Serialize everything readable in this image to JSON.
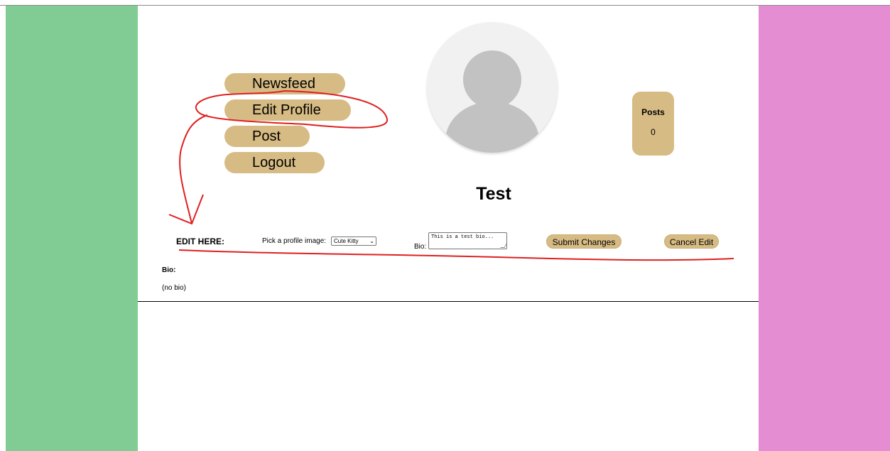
{
  "nav": {
    "newsfeed_label": "Newsfeed",
    "edit_profile_label": "Edit Profile",
    "post_label": "Post",
    "logout_label": "Logout"
  },
  "profile": {
    "username": "Test",
    "posts_label": "Posts",
    "posts_count": "0"
  },
  "edit_form": {
    "heading": "EDIT HERE:",
    "pick_image_label": "Pick a profile image:",
    "selected_image": "Cute Kitty",
    "bio_label": "Bio:",
    "bio_value": "This is a test bio...",
    "submit_label": "Submit Changes",
    "cancel_label": "Cancel Edit"
  },
  "bio_section": {
    "heading": "Bio:",
    "text": "(no bio)"
  },
  "colors": {
    "left_rail": "#80cc94",
    "right_rail": "#e48dd3",
    "button": "#d7bb84",
    "annotation": "#e02020"
  }
}
